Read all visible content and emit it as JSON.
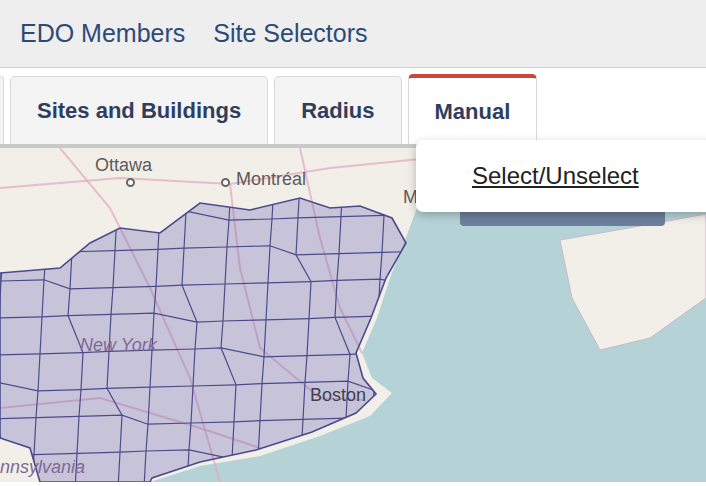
{
  "topnav": {
    "items": [
      {
        "label": "EDO Members"
      },
      {
        "label": "Site Selectors"
      }
    ]
  },
  "tabs": [
    {
      "label": "Sites and Buildings",
      "selected": false
    },
    {
      "label": "Radius",
      "selected": false
    },
    {
      "label": "Manual",
      "selected": true
    }
  ],
  "dropdown": {
    "items": [
      {
        "label": "Select/Unselect"
      }
    ]
  },
  "map": {
    "labels": [
      {
        "text": "Ottawa",
        "kind": "city"
      },
      {
        "text": "Montréal",
        "kind": "city"
      },
      {
        "text": "M",
        "kind": "place"
      },
      {
        "text": "New York",
        "kind": "region"
      },
      {
        "text": "Boston",
        "kind": "major"
      },
      {
        "text": "nnsylvania",
        "kind": "region"
      }
    ]
  }
}
